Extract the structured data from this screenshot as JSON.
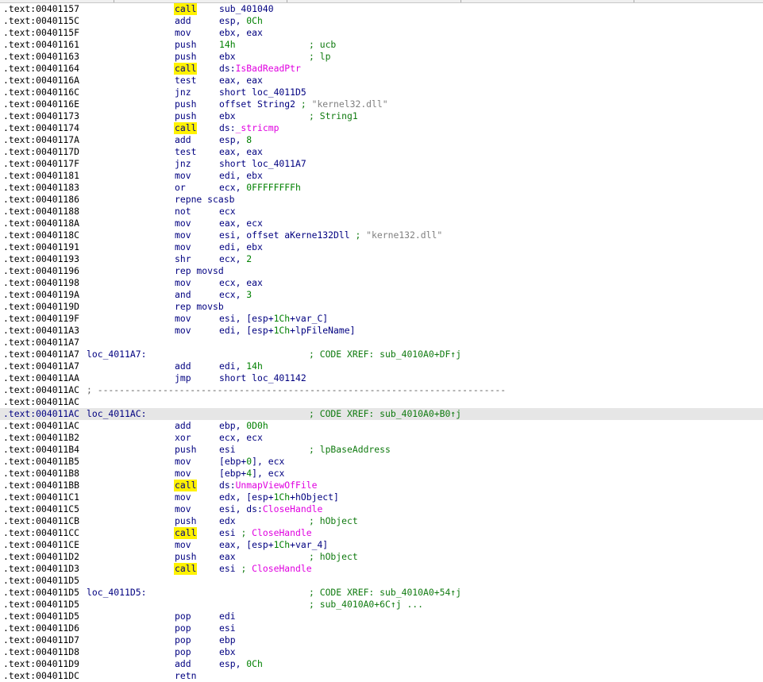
{
  "lines": [
    {
      "a": ".text:00401157",
      "m": "call",
      "o": [
        {
          "t": "sub_401040"
        }
      ]
    },
    {
      "a": ".text:0040115C",
      "m": "add",
      "o": [
        {
          "t": "esp, "
        },
        {
          "t": "0Ch",
          "k": "num"
        }
      ]
    },
    {
      "a": ".text:0040115F",
      "m": "mov",
      "o": [
        {
          "t": "ebx, eax"
        }
      ]
    },
    {
      "a": ".text:00401161",
      "m": "push",
      "o": [
        {
          "t": "14h",
          "k": "num"
        }
      ],
      "c": "; ucb"
    },
    {
      "a": ".text:00401163",
      "m": "push",
      "o": [
        {
          "t": "ebx"
        }
      ],
      "c": "; lp"
    },
    {
      "a": ".text:00401164",
      "m": "call",
      "o": [
        {
          "t": "ds:"
        },
        {
          "t": "IsBadReadPtr",
          "k": "api"
        }
      ]
    },
    {
      "a": ".text:0040116A",
      "m": "test",
      "o": [
        {
          "t": "eax, eax"
        }
      ]
    },
    {
      "a": ".text:0040116C",
      "m": "jnz",
      "o": [
        {
          "t": "short loc_4011D5"
        }
      ]
    },
    {
      "a": ".text:0040116E",
      "m": "push",
      "o": [
        {
          "t": "offset String2 "
        },
        {
          "t": "; ",
          "k": "icm"
        },
        {
          "t": "\"kernel32.dll\"",
          "k": "str"
        }
      ]
    },
    {
      "a": ".text:00401173",
      "m": "push",
      "o": [
        {
          "t": "ebx"
        }
      ],
      "c": "; String1"
    },
    {
      "a": ".text:00401174",
      "m": "call",
      "o": [
        {
          "t": "ds:"
        },
        {
          "t": "_stricmp",
          "k": "api"
        }
      ]
    },
    {
      "a": ".text:0040117A",
      "m": "add",
      "o": [
        {
          "t": "esp, "
        },
        {
          "t": "8",
          "k": "num"
        }
      ]
    },
    {
      "a": ".text:0040117D",
      "m": "test",
      "o": [
        {
          "t": "eax, eax"
        }
      ]
    },
    {
      "a": ".text:0040117F",
      "m": "jnz",
      "o": [
        {
          "t": "short loc_4011A7"
        }
      ]
    },
    {
      "a": ".text:00401181",
      "m": "mov",
      "o": [
        {
          "t": "edi, ebx"
        }
      ]
    },
    {
      "a": ".text:00401183",
      "m": "or",
      "o": [
        {
          "t": "ecx, "
        },
        {
          "t": "0FFFFFFFFh",
          "k": "num"
        }
      ]
    },
    {
      "a": ".text:00401186",
      "m": "repne scasb",
      "o": []
    },
    {
      "a": ".text:00401188",
      "m": "not",
      "o": [
        {
          "t": "ecx"
        }
      ]
    },
    {
      "a": ".text:0040118A",
      "m": "mov",
      "o": [
        {
          "t": "eax, ecx"
        }
      ]
    },
    {
      "a": ".text:0040118C",
      "m": "mov",
      "o": [
        {
          "t": "esi, offset aKerne132Dll "
        },
        {
          "t": "; ",
          "k": "icm"
        },
        {
          "t": "\"kerne132.dll\"",
          "k": "str"
        }
      ]
    },
    {
      "a": ".text:00401191",
      "m": "mov",
      "o": [
        {
          "t": "edi, ebx"
        }
      ]
    },
    {
      "a": ".text:00401193",
      "m": "shr",
      "o": [
        {
          "t": "ecx, "
        },
        {
          "t": "2",
          "k": "num"
        }
      ]
    },
    {
      "a": ".text:00401196",
      "m": "rep movsd",
      "o": []
    },
    {
      "a": ".text:00401198",
      "m": "mov",
      "o": [
        {
          "t": "ecx, eax"
        }
      ]
    },
    {
      "a": ".text:0040119A",
      "m": "and",
      "o": [
        {
          "t": "ecx, "
        },
        {
          "t": "3",
          "k": "num"
        }
      ]
    },
    {
      "a": ".text:0040119D",
      "m": "rep movsb",
      "o": []
    },
    {
      "a": ".text:0040119F",
      "m": "mov",
      "o": [
        {
          "t": "esi, [esp+"
        },
        {
          "t": "1Ch",
          "k": "num"
        },
        {
          "t": "+var_C]"
        }
      ]
    },
    {
      "a": ".text:004011A3",
      "m": "mov",
      "o": [
        {
          "t": "edi, [esp+"
        },
        {
          "t": "1Ch",
          "k": "num"
        },
        {
          "t": "+lpFileName]"
        }
      ]
    },
    {
      "a": ".text:004011A7"
    },
    {
      "a": ".text:004011A7",
      "l": "loc_4011A7:",
      "c": "; CODE XREF: sub_4010A0+DF↑j"
    },
    {
      "a": ".text:004011A7",
      "m": "add",
      "o": [
        {
          "t": "edi, "
        },
        {
          "t": "14h",
          "k": "num"
        }
      ]
    },
    {
      "a": ".text:004011AA",
      "m": "jmp",
      "o": [
        {
          "t": "short loc_401142"
        }
      ]
    },
    {
      "a": ".text:004011AC",
      "s": "; ---------------------------------------------------------------------------"
    },
    {
      "a": ".text:004011AC"
    },
    {
      "a": ".text:004011AC",
      "l": "loc_4011AC:",
      "c": "; CODE XREF: sub_4010A0+B0↑j",
      "hl": true
    },
    {
      "a": ".text:004011AC",
      "m": "add",
      "o": [
        {
          "t": "ebp, "
        },
        {
          "t": "0D0h",
          "k": "num"
        }
      ]
    },
    {
      "a": ".text:004011B2",
      "m": "xor",
      "o": [
        {
          "t": "ecx, ecx"
        }
      ]
    },
    {
      "a": ".text:004011B4",
      "m": "push",
      "o": [
        {
          "t": "esi"
        }
      ],
      "c": "; lpBaseAddress"
    },
    {
      "a": ".text:004011B5",
      "m": "mov",
      "o": [
        {
          "t": "[ebp+"
        },
        {
          "t": "0",
          "k": "num"
        },
        {
          "t": "], ecx"
        }
      ]
    },
    {
      "a": ".text:004011B8",
      "m": "mov",
      "o": [
        {
          "t": "[ebp+"
        },
        {
          "t": "4",
          "k": "num"
        },
        {
          "t": "], ecx"
        }
      ]
    },
    {
      "a": ".text:004011BB",
      "m": "call",
      "o": [
        {
          "t": "ds:"
        },
        {
          "t": "UnmapViewOfFile",
          "k": "api"
        }
      ]
    },
    {
      "a": ".text:004011C1",
      "m": "mov",
      "o": [
        {
          "t": "edx, [esp+"
        },
        {
          "t": "1Ch",
          "k": "num"
        },
        {
          "t": "+hObject]"
        }
      ]
    },
    {
      "a": ".text:004011C5",
      "m": "mov",
      "o": [
        {
          "t": "esi, ds:"
        },
        {
          "t": "CloseHandle",
          "k": "api"
        }
      ]
    },
    {
      "a": ".text:004011CB",
      "m": "push",
      "o": [
        {
          "t": "edx"
        }
      ],
      "c": "; hObject"
    },
    {
      "a": ".text:004011CC",
      "m": "call",
      "o": [
        {
          "t": "esi "
        },
        {
          "t": "; ",
          "k": "icm"
        },
        {
          "t": "CloseHandle",
          "k": "api"
        }
      ]
    },
    {
      "a": ".text:004011CE",
      "m": "mov",
      "o": [
        {
          "t": "eax, [esp+"
        },
        {
          "t": "1Ch",
          "k": "num"
        },
        {
          "t": "+var_4]"
        }
      ]
    },
    {
      "a": ".text:004011D2",
      "m": "push",
      "o": [
        {
          "t": "eax"
        }
      ],
      "c": "; hObject"
    },
    {
      "a": ".text:004011D3",
      "m": "call",
      "o": [
        {
          "t": "esi "
        },
        {
          "t": "; ",
          "k": "icm"
        },
        {
          "t": "CloseHandle",
          "k": "api"
        }
      ]
    },
    {
      "a": ".text:004011D5"
    },
    {
      "a": ".text:004011D5",
      "l": "loc_4011D5:",
      "c": "; CODE XREF: sub_4010A0+54↑j"
    },
    {
      "a": ".text:004011D5",
      "c": "; sub_4010A0+6C↑j ..."
    },
    {
      "a": ".text:004011D5",
      "m": "pop",
      "o": [
        {
          "t": "edi"
        }
      ]
    },
    {
      "a": ".text:004011D6",
      "m": "pop",
      "o": [
        {
          "t": "esi"
        }
      ]
    },
    {
      "a": ".text:004011D7",
      "m": "pop",
      "o": [
        {
          "t": "ebp"
        }
      ]
    },
    {
      "a": ".text:004011D8",
      "m": "pop",
      "o": [
        {
          "t": "ebx"
        }
      ]
    },
    {
      "a": ".text:004011D9",
      "m": "add",
      "o": [
        {
          "t": "esp, "
        },
        {
          "t": "0Ch",
          "k": "num"
        }
      ]
    },
    {
      "a": ".text:004011DC",
      "m": "retn",
      "o": []
    }
  ],
  "colors": {
    "instruction": "#000080",
    "number": "#008000",
    "api": "#e000e0",
    "string": "#808080",
    "comment": "#0f7a0f",
    "call_highlight": "#fff200",
    "current_line": "#e6e6e6"
  }
}
